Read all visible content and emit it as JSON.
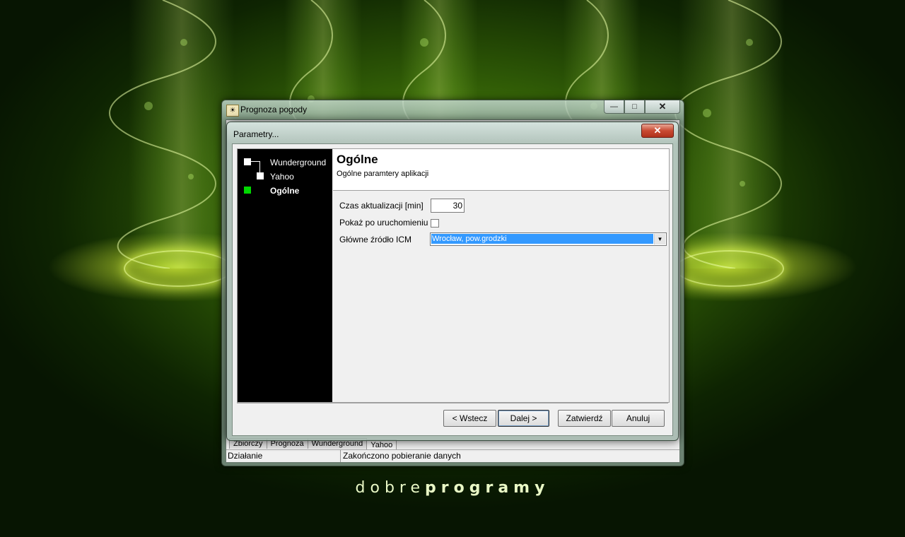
{
  "background": {
    "brand_light": "dobre",
    "brand_bold": "programy",
    "accent_color": "#8bd11a"
  },
  "main_window": {
    "title": "Prognoza pogody",
    "controls": {
      "minimize": "—",
      "maximize": "□",
      "close": "✕"
    },
    "tabs": [
      "Zbiorczy",
      "Prognoza",
      "Wunderground",
      "Yahoo"
    ],
    "active_tab": "Yahoo",
    "status": {
      "left": "Działanie",
      "right": "Zakończono pobieranie danych"
    }
  },
  "dialog": {
    "title": "Parametry...",
    "close_icon": "✕",
    "tree": {
      "items": [
        {
          "label": "Wunderground",
          "state": "normal"
        },
        {
          "label": "Yahoo",
          "state": "normal"
        },
        {
          "label": "Ogólne",
          "state": "current"
        }
      ]
    },
    "header": {
      "title": "Ogólne",
      "subtitle": "Ogólne paramtery aplikacji"
    },
    "fields": {
      "update_label": "Czas aktualizacji [min]",
      "update_value": "30",
      "show_label": "Pokaż po uruchomieniu",
      "show_checked": false,
      "source_label": "Główne źródło ICM",
      "source_value": "Wrocław, pow.grodzki"
    },
    "buttons": {
      "back": "< Wstecz",
      "next": "Dalej >",
      "confirm": "Zatwierdź",
      "cancel": "Anuluj"
    }
  }
}
